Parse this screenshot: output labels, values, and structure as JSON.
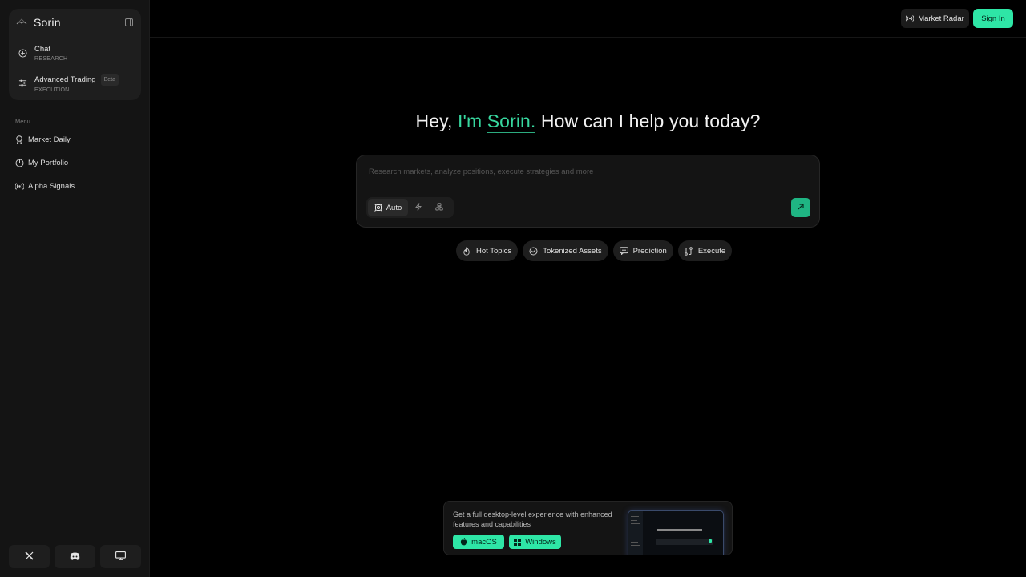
{
  "brand": {
    "name": "Sorin"
  },
  "sidebar": {
    "primary": [
      {
        "title": "Chat",
        "subtitle": "RESEARCH",
        "icon": "chat-plus-icon"
      },
      {
        "title": "Advanced Trading",
        "badge": "Beta",
        "subtitle": "EXECUTION",
        "icon": "sliders-icon"
      }
    ],
    "menu_label": "Menu",
    "menu": [
      {
        "label": "Market Daily",
        "icon": "award-icon"
      },
      {
        "label": "My Portfolio",
        "icon": "pie-chart-icon"
      },
      {
        "label": "Alpha Signals",
        "icon": "broadcast-icon"
      }
    ],
    "social": [
      "x-icon",
      "discord-icon",
      "desktop-icon"
    ]
  },
  "topbar": {
    "radar_label": "Market Radar",
    "signin_label": "Sign In"
  },
  "hero": {
    "prefix": "Hey, ",
    "accent_a": "I'm ",
    "accent_name": "Sorin.",
    "suffix": " How can I help you today?"
  },
  "prompt": {
    "placeholder": "Research markets, analyze positions, execute strategies and more",
    "mode_label": "Auto"
  },
  "chips": [
    {
      "label": "Hot Topics",
      "icon": "flame-icon"
    },
    {
      "label": "Tokenized Assets",
      "icon": "refresh-coin-icon"
    },
    {
      "label": "Prediction",
      "icon": "message-square-icon"
    },
    {
      "label": "Execute",
      "icon": "git-compare-icon"
    }
  ],
  "banner": {
    "text": "Get a full desktop-level experience with enhanced features and capabilities",
    "mac_label": "macOS",
    "win_label": "Windows"
  },
  "colors": {
    "accent": "#2ee6a6",
    "accent_text": "#37d79f",
    "bg": "#000000",
    "sidebar": "#141414"
  }
}
